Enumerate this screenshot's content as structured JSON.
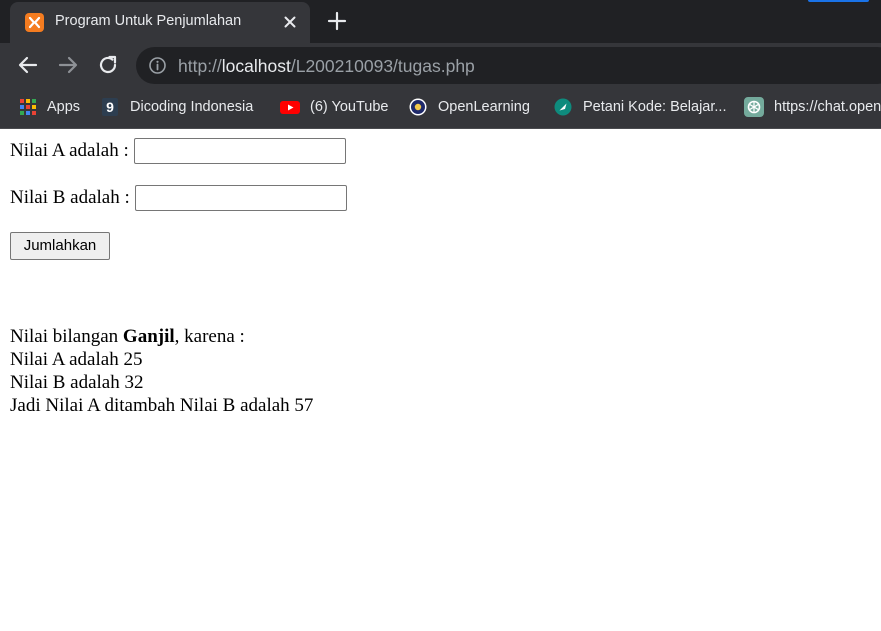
{
  "browser": {
    "tab": {
      "title": "Program Untuk Penjumlahan"
    },
    "address": {
      "scheme": "http://",
      "host": "localhost",
      "path": "/L200210093/tugas.php"
    },
    "bookmarks": [
      {
        "label": "Apps",
        "icon": "apps-grid-icon"
      },
      {
        "label": "Dicoding Indonesia",
        "icon": "dicoding-icon"
      },
      {
        "label": "(6) YouTube",
        "icon": "youtube-icon"
      },
      {
        "label": "OpenLearning",
        "icon": "openlearning-icon"
      },
      {
        "label": "Petani Kode: Belajar...",
        "icon": "petanikode-icon"
      },
      {
        "label": "https://chat.openai.com",
        "icon": "chatgpt-icon"
      }
    ]
  },
  "form": {
    "label_a": "Nilai A adalah :",
    "label_b": "Nilai B adalah :",
    "value_a": "",
    "value_b": "",
    "submit_label": "Jumlahkan"
  },
  "result": {
    "prefix": "Nilai bilangan ",
    "parity": "Ganjil",
    "suffix": ", karena :",
    "line_a": "Nilai A adalah 25",
    "line_b": "Nilai B adalah 32",
    "line_sum": "Jadi Nilai A ditambah Nilai B adalah 57"
  },
  "colors": {
    "chrome_dark": "#202124",
    "chrome_toolbar": "#35363a",
    "xampp_orange": "#f47c20",
    "youtube_red": "#ff0000"
  }
}
